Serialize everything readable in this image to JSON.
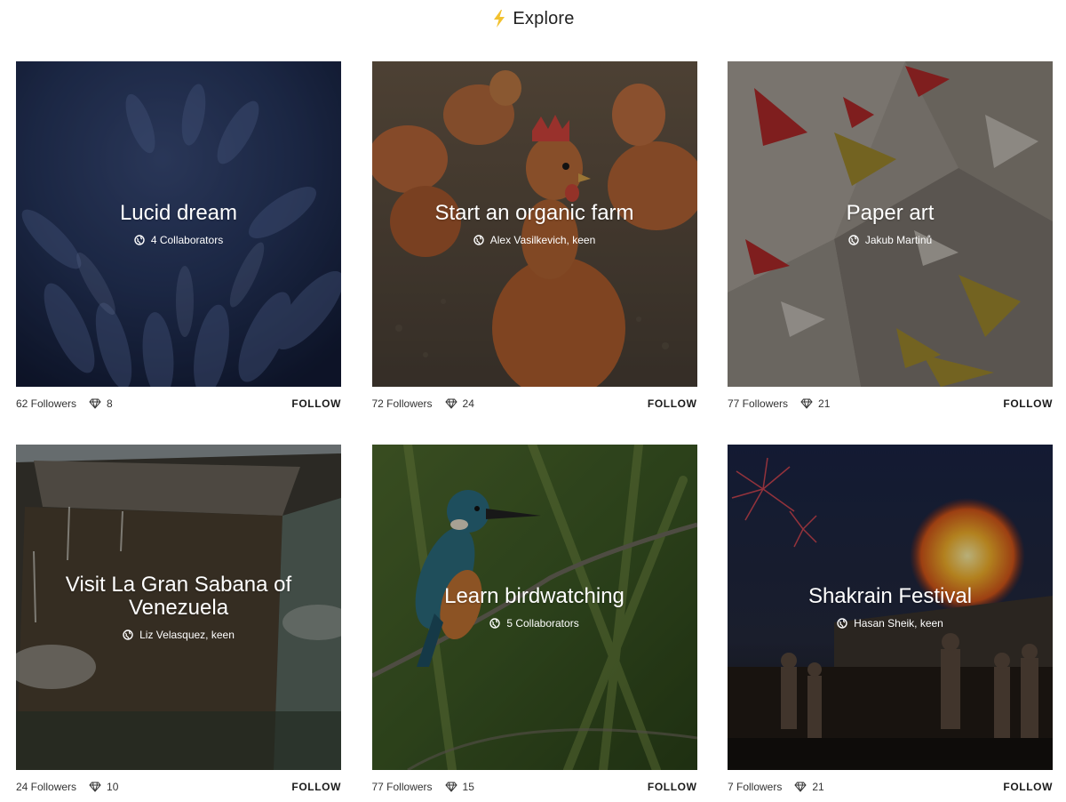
{
  "header": {
    "icon": "lightning-icon",
    "title": "Explore",
    "icon_color": "#f2c12e"
  },
  "cards": [
    {
      "title": "Lucid dream",
      "subtitle": "4 Collaborators",
      "followers": "62 Followers",
      "likes": "8",
      "follow_label": "FOLLOW",
      "theme": "blue-feathers"
    },
    {
      "title": "Start an organic farm",
      "subtitle": "Alex Vasilkevich, keen",
      "followers": "72 Followers",
      "likes": "24",
      "follow_label": "FOLLOW",
      "theme": "chickens"
    },
    {
      "title": "Paper art",
      "subtitle": "Jakub Martinů",
      "followers": "77 Followers",
      "likes": "21",
      "follow_label": "FOLLOW",
      "theme": "paper-cranes"
    },
    {
      "title": "Visit La Gran Sabana of Venezuela",
      "subtitle": "Liz Velasquez, keen",
      "followers": "24 Followers",
      "likes": "10",
      "follow_label": "FOLLOW",
      "theme": "tepui-mountain"
    },
    {
      "title": "Learn birdwatching",
      "subtitle": "5 Collaborators",
      "followers": "77 Followers",
      "likes": "15",
      "follow_label": "FOLLOW",
      "theme": "kingfisher"
    },
    {
      "title": "Shakrain Festival",
      "subtitle": "Hasan Sheik, keen",
      "followers": "7 Followers",
      "likes": "21",
      "follow_label": "FOLLOW",
      "theme": "fire-festival"
    }
  ]
}
